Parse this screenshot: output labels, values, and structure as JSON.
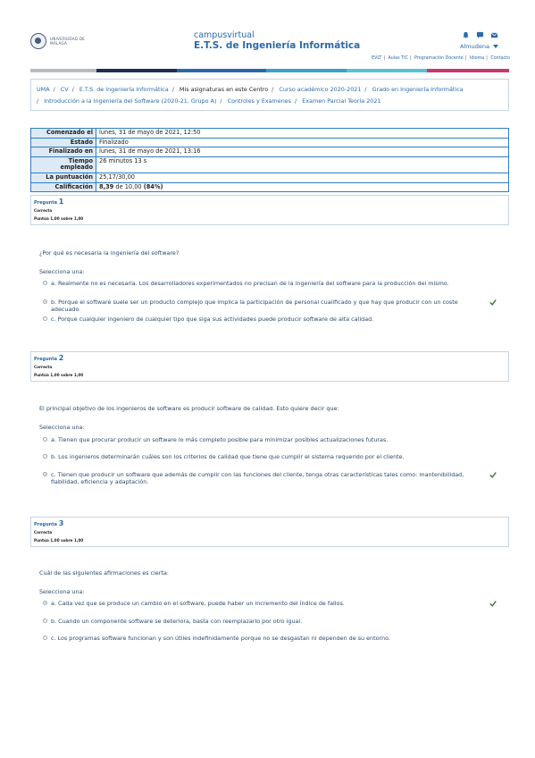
{
  "header": {
    "logo_text": "UNIVERSIDAD DE MÁLAGA",
    "site_line1": "campusvirtual",
    "site_line2": "E.T.S. de Ingeniería Informática",
    "user_name": "Almudena",
    "links": [
      "EVLT",
      "Aulas TIC",
      "Programación Docente",
      "Idioma",
      "Contacto"
    ],
    "bar_colors": [
      "#b8bcc2",
      "#b8bcc2",
      "#1e2f55",
      "#2b6aa8",
      "#3aa1c8",
      "#5ac0d6",
      "#c8386a"
    ]
  },
  "breadcrumbs": {
    "items": [
      "UMA",
      "CV",
      "E.T.S. de Ingeniería Informática",
      "Mis asignaturas en este Centro",
      "Curso académico 2020-2021",
      "Grado en Ingeniería Informática"
    ],
    "items2": [
      "Introducción a la Ingeniería del Software (2020-21, Grupo A)",
      "Controles y Examenes",
      "Examen Parcial Teoría 2021"
    ]
  },
  "summary": [
    {
      "k": "Comenzado el",
      "v": "lunes, 31 de mayo de 2021, 12:50"
    },
    {
      "k": "Estado",
      "v": "Finalizado"
    },
    {
      "k": "Finalizado en",
      "v": "lunes, 31 de mayo de 2021, 13:16"
    },
    {
      "k": "Tiempo empleado",
      "v": "26 minutos 13 s"
    },
    {
      "k": "La puntuación",
      "v": "25,17/30,00"
    },
    {
      "k": "Calificación",
      "v_bold": "8,39",
      "v_mid": " de 10,00 ",
      "v_pct": "(84%)"
    }
  ],
  "questions": [
    {
      "label": "Pregunta",
      "num": "1",
      "status": "Correcta",
      "points": "Puntúa 1,00 sobre 1,00",
      "text": "¿Por qué es necesaria la ingeniería del software?",
      "select": "Selecciona una:",
      "answers": [
        {
          "text": "a. Realmente no es necesaria. Los desarrolladores experimentados no precisan de la ingeniería del software para la producción del mismo.",
          "selected": false,
          "correct": false
        },
        {
          "text": "b. Porque el software suele ser un producto complejo que implica la participación de personal cualificado y que hay que producir con un coste adecuado.",
          "selected": true,
          "correct": true
        },
        {
          "text": "c. Porque cualquier ingeniero de cualquier tipo que siga sus actividades puede producir software de alta calidad.",
          "selected": false,
          "correct": false
        }
      ]
    },
    {
      "label": "Pregunta",
      "num": "2",
      "status": "Correcta",
      "points": "Puntúa 1,00 sobre 1,00",
      "text": "El principal objetivo de los ingenieros de software es producir software de calidad. Esto quiere decir que:",
      "select": "Selecciona una:",
      "answers": [
        {
          "text": "a. Tienen que procurar producir un software lo más completo posible para minimizar posibles actualizaciones futuras.",
          "selected": false,
          "correct": false
        },
        {
          "text": "b. Los ingenieros determinarán cuáles son los criterios de calidad que tiene que cumplir el sistema requerido por el cliente.",
          "selected": false,
          "correct": false
        },
        {
          "text": "c. Tienen que producir un software que además de cumplir con las funciones del cliente, tenga otras características tales como: mantenibilidad, fiabilidad, eficiencia y adaptación.",
          "selected": true,
          "correct": true
        }
      ]
    },
    {
      "label": "Pregunta",
      "num": "3",
      "status": "Correcta",
      "points": "Puntúa 1,00 sobre 1,00",
      "text": "Cuál de las siguientes afirmaciones es cierta:",
      "select": "Selecciona una:",
      "answers": [
        {
          "text": "a. Cada vez que se produce un cambio en el software, puede haber un incremento del índice de fallos.",
          "selected": true,
          "correct": true
        },
        {
          "text": "b. Cuando un componente software se deteriora, basta con reemplazarlo por otro igual.",
          "selected": false,
          "correct": false
        },
        {
          "text": "c. Los programas software funcionan y son útiles indefinidamente porque no se desgastan ni dependen de su entorno.",
          "selected": false,
          "correct": false
        }
      ]
    }
  ]
}
